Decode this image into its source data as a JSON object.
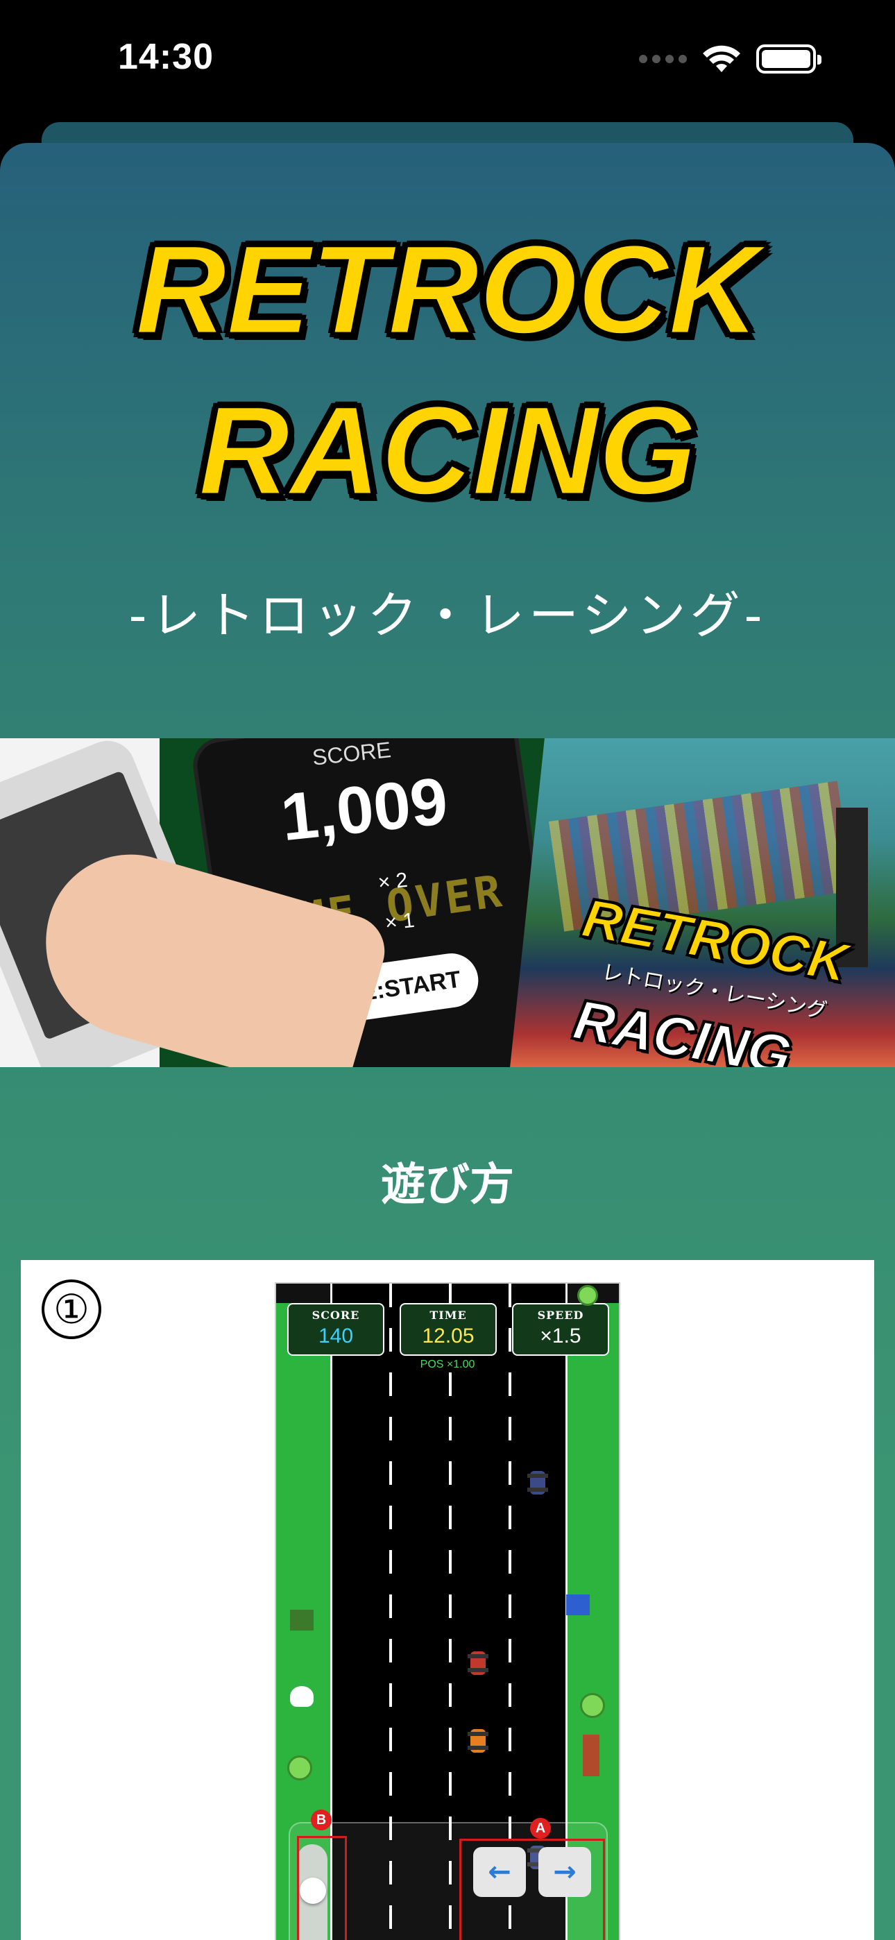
{
  "status_bar": {
    "time": "14:30"
  },
  "hero": {
    "title_line1": "RETROCK",
    "title_line2": "RACING",
    "subtitle": "-レトロック・レーシング-"
  },
  "banner": {
    "score_label": "SCORE",
    "score_value": "1,009",
    "game_over": "GAME OVER",
    "multiplier_1": "× 2",
    "multiplier_2": "× 1",
    "restart_label": "RE:START",
    "art_title_1": "RETROCK",
    "art_subtitle": "レトロック・レーシング",
    "art_title_2": "RACING"
  },
  "how_to_play": {
    "title": "遊び方",
    "step_number": "①",
    "game": {
      "score_label": "SCORE",
      "score_value": "140",
      "time_label": "TIME",
      "time_value": "12.05",
      "speed_label": "SPEED",
      "speed_value": "×1.5",
      "pos_text": "POS ×1.00",
      "slider_level": 0.25,
      "left_arrow": "←",
      "right_arrow": "→",
      "badge_b": "B",
      "badge_a": "A"
    }
  },
  "colors": {
    "title_yellow": "#ffd400",
    "score_cyan": "#3fd0ff",
    "time_yellow": "#ffe84a",
    "speed_white": "#ffffff",
    "highlight_red": "#d01c1c"
  }
}
